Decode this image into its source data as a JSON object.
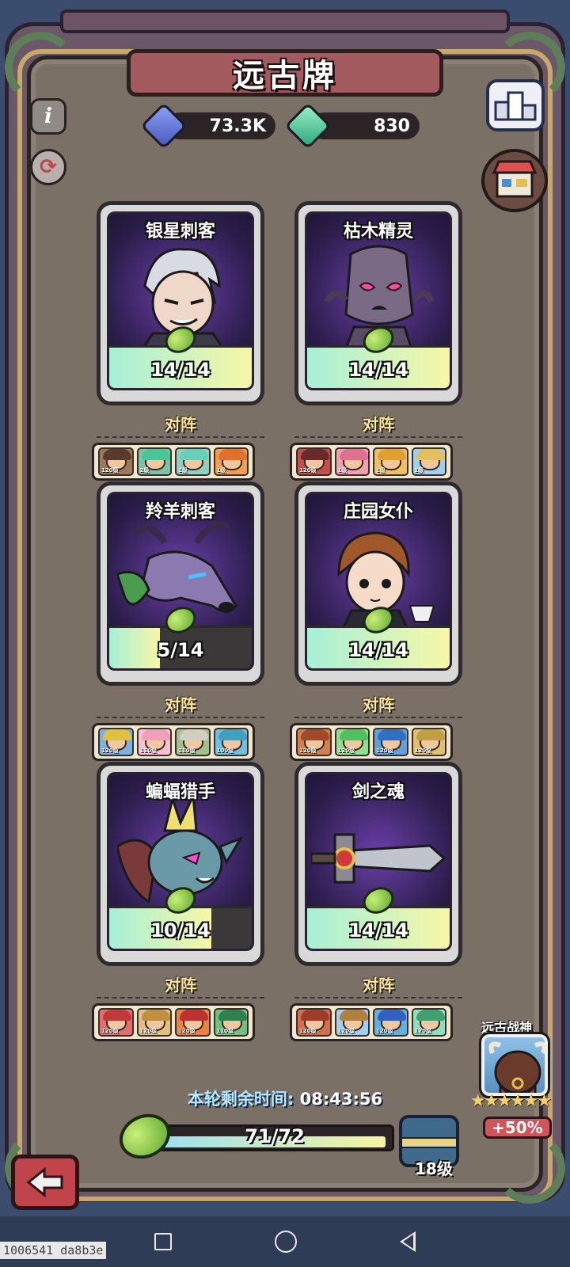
{
  "title": "远古牌",
  "currency": {
    "blue_crystal": "73.3K",
    "green_crystal": "830"
  },
  "cards": [
    {
      "name": "银星刺客",
      "progress_text": "14/14",
      "progress": 1.0,
      "lineup_label": "对阵",
      "char_color": "#d8dbe4",
      "heroes": [
        {
          "hair": "#5a3a2a",
          "bg": "#9a7a5a",
          "lv": "120级"
        },
        {
          "hair": "#4ac59a",
          "bg": "#7fc0a8",
          "lv": "2级"
        },
        {
          "hair": "#66d0b8",
          "bg": "#8fd0c0",
          "lv": "1级"
        },
        {
          "hair": "#e0702a",
          "bg": "#f0a050",
          "lv": "1级"
        }
      ]
    },
    {
      "name": "枯木精灵",
      "progress_text": "14/14",
      "progress": 1.0,
      "lineup_label": "对阵",
      "char_color": "#7a6a86",
      "heroes": [
        {
          "hair": "#6a2a2a",
          "bg": "#c05050",
          "lv": "120级"
        },
        {
          "hair": "#e07090",
          "bg": "#f0a0b0",
          "lv": "1级"
        },
        {
          "hair": "#e0a030",
          "bg": "#f0c060",
          "lv": "1级"
        },
        {
          "hair": "#e0c060",
          "bg": "#a0d0f0",
          "lv": "1级"
        }
      ]
    },
    {
      "name": "羚羊刺客",
      "progress_text": "5/14",
      "progress": 0.357,
      "lineup_label": "对阵",
      "char_color": "#8a7ab0",
      "heroes": [
        {
          "hair": "#e0c040",
          "bg": "#80b0e0",
          "lv": "120级"
        },
        {
          "hair": "#f0a0b8",
          "bg": "#f8c0d0",
          "lv": "110级"
        },
        {
          "hair": "#d0d0c0",
          "bg": "#a0c090",
          "lv": "110级"
        },
        {
          "hair": "#40a0c0",
          "bg": "#70c0e0",
          "lv": "100级"
        }
      ]
    },
    {
      "name": "庄园女仆",
      "progress_text": "14/14",
      "progress": 1.0,
      "lineup_label": "对阵",
      "char_color": "#f0d0b0",
      "heroes": [
        {
          "hair": "#a04a2a",
          "bg": "#d08050",
          "lv": "120级"
        },
        {
          "hair": "#50c060",
          "bg": "#90e090",
          "lv": "120级"
        },
        {
          "hair": "#3070c0",
          "bg": "#60a0e0",
          "lv": "120级"
        },
        {
          "hair": "#c0a040",
          "bg": "#e0c070",
          "lv": "120级"
        }
      ]
    },
    {
      "name": "蝙蝠猎手",
      "progress_text": "10/14",
      "progress": 0.714,
      "lineup_label": "对阵",
      "char_color": "#6a9aa8",
      "heroes": [
        {
          "hair": "#c03a3a",
          "bg": "#e07070",
          "lv": "120级"
        },
        {
          "hair": "#c09040",
          "bg": "#e0c080",
          "lv": "120级"
        },
        {
          "hair": "#c03030",
          "bg": "#f08040",
          "lv": "120级"
        },
        {
          "hair": "#308050",
          "bg": "#70c080",
          "lv": "110级"
        }
      ]
    },
    {
      "name": "剑之魂",
      "progress_text": "14/14",
      "progress": 1.0,
      "lineup_label": "对阵",
      "char_color": "#c0c4cc",
      "heroes": [
        {
          "hair": "#a03a2a",
          "bg": "#d07050",
          "lv": "120级"
        },
        {
          "hair": "#b08040",
          "bg": "#a0d0f0",
          "lv": "120级"
        },
        {
          "hair": "#3060c0",
          "bg": "#60b0e0",
          "lv": "120级"
        },
        {
          "hair": "#40a070",
          "bg": "#90e0c0",
          "lv": "120级"
        }
      ]
    }
  ],
  "timer": {
    "label": "本轮剩余时间:",
    "value": "08:43:56"
  },
  "progress": {
    "text": "71/72",
    "value": 0.986,
    "level": "18级"
  },
  "ancient_god": {
    "label": "远古战神",
    "stars": "★★★★★★",
    "bonus": "+50%"
  },
  "icons": {
    "info": "i",
    "refresh": "⟳",
    "back": "back-arrow-icon"
  },
  "watermark": "1006541 da8b3e"
}
